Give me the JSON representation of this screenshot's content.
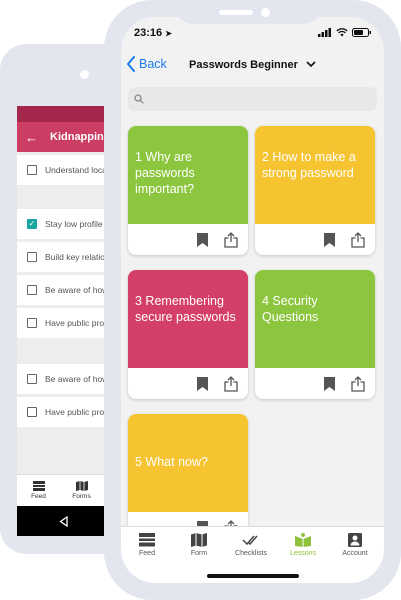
{
  "android": {
    "header_title": "Kidnapping",
    "checklist": [
      {
        "label": "Understand local",
        "checked": false
      },
      {
        "label": "Stay low profile",
        "checked": true
      },
      {
        "label": "Build key relationships",
        "checked": false
      },
      {
        "label": "Be aware of how",
        "checked": false
      },
      {
        "label": "Have public profile",
        "checked": false
      },
      {
        "label": "Be aware of how",
        "checked": false
      },
      {
        "label": "Have public profile",
        "checked": false
      }
    ],
    "nav": [
      {
        "label": "Feed",
        "icon": "feed-icon"
      },
      {
        "label": "Forms",
        "icon": "map-icon"
      }
    ]
  },
  "status": {
    "time": "23:16"
  },
  "nav": {
    "back_label": "Back",
    "title": "Passwords Beginner"
  },
  "search": {
    "placeholder": ""
  },
  "lessons": [
    {
      "title": "1 Why are passwords important?",
      "color": "#8cc63f"
    },
    {
      "title": "2 How to make a strong password",
      "color": "#f6c431"
    },
    {
      "title": "3 Remembering secure passwords",
      "color": "#d43f68"
    },
    {
      "title": "4 Security Questions",
      "color": "#8cc63f"
    },
    {
      "title": "5 What now?",
      "color": "#f6c431"
    }
  ],
  "tabs": [
    {
      "label": "Feed",
      "icon": "feed-icon",
      "active": false
    },
    {
      "label": "Form",
      "icon": "map-icon",
      "active": false
    },
    {
      "label": "Checklists",
      "icon": "checks-icon",
      "active": false
    },
    {
      "label": "Lessons",
      "icon": "lessons-icon",
      "active": true
    },
    {
      "label": "Account",
      "icon": "account-icon",
      "active": false
    }
  ],
  "colors": {
    "accent": "#1a7bf0",
    "lessons_active": "#90c13d",
    "android_header": "#cc3d64"
  }
}
